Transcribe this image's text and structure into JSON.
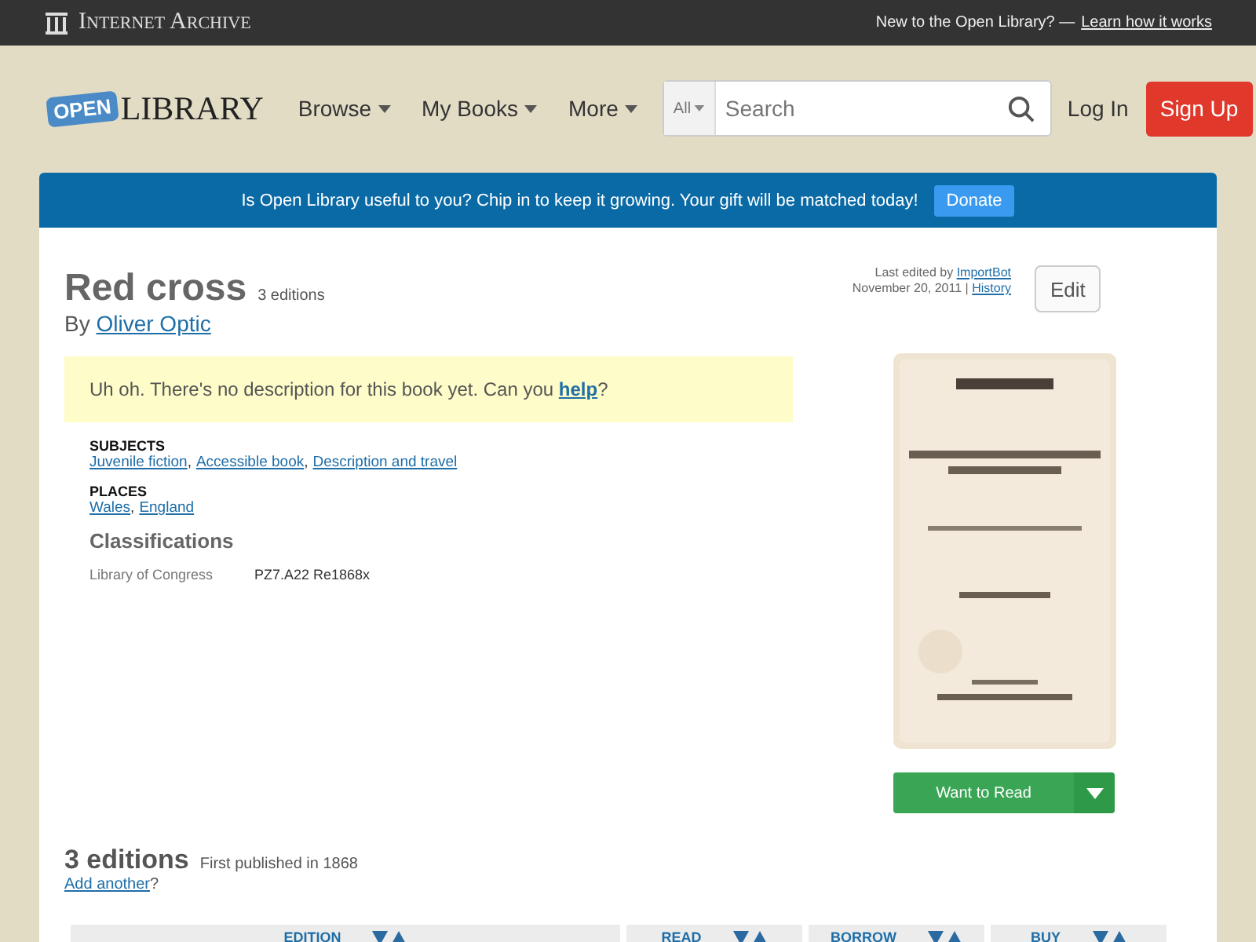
{
  "top_bar": {
    "brand": "Internet Archive",
    "prompt": "New to the Open Library? —",
    "link": "Learn how it works"
  },
  "header": {
    "logo_tag": "OPEN",
    "logo_word": "LIBRARY",
    "nav": [
      {
        "label": "Browse"
      },
      {
        "label": "My Books"
      },
      {
        "label": "More"
      }
    ],
    "search": {
      "scope": "All",
      "placeholder": "Search"
    },
    "login": "Log In",
    "signup": "Sign Up"
  },
  "banner": {
    "text": "Is Open Library useful to you? Chip in to keep it growing. Your gift will be matched today!",
    "button": "Donate"
  },
  "book": {
    "title": "Red cross",
    "editions_count": "3 editions",
    "by": "By",
    "author": "Oliver Optic",
    "edit_info": {
      "prefix": "Last edited by",
      "user": "ImportBot",
      "date": "November 20, 2011 |",
      "history": "History"
    },
    "edit_button": "Edit",
    "notice": "Uh oh. There's no description for this book yet. Can you ",
    "notice_link": "help",
    "notice_end": "?",
    "subject_groups": [
      {
        "heading": "SUBJECTS",
        "separator": ",",
        "links": [
          "Juvenile fiction",
          "Accessible book",
          "Description and travel"
        ]
      },
      {
        "heading": "PLACES",
        "separator": ",",
        "links": [
          "Wales",
          "England"
        ]
      }
    ],
    "classifications": {
      "heading": "Classifications",
      "rows": [
        {
          "label": "Library of Congress",
          "value": "PZ7.A22 Re1868x"
        }
      ]
    },
    "want_button": "Want to Read"
  },
  "editions": {
    "heading": "3 editions",
    "first_published": "First published in 1868",
    "add_link": "Add another",
    "add_end": "?",
    "columns": [
      {
        "label": "EDITION"
      },
      {
        "label": "READ"
      },
      {
        "label": "BORROW"
      },
      {
        "label": "BUY"
      }
    ]
  }
}
